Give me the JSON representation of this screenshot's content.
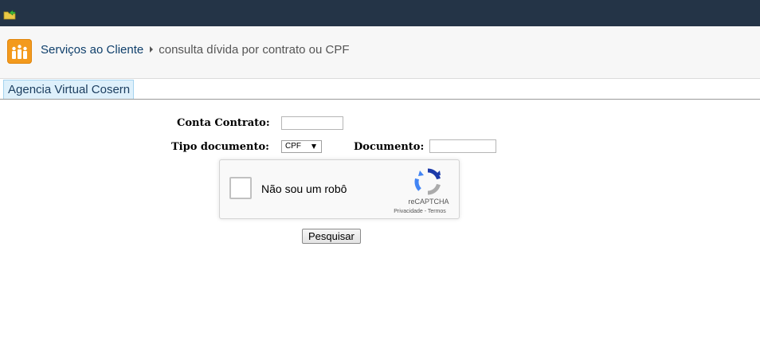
{
  "header": {
    "breadcrumb_root": "Serviços ao Cliente",
    "breadcrumb_current": "consulta dívida por contrato ou CPF"
  },
  "tab": {
    "label": "Agencia Virtual Cosern"
  },
  "form": {
    "conta_contrato_label": "Conta Contrato:",
    "conta_contrato_value": "",
    "tipo_documento_label": "Tipo documento:",
    "tipo_documento_selected": "CPF",
    "documento_label": "Documento:",
    "documento_value": "",
    "submit_label": "Pesquisar"
  },
  "recaptcha": {
    "checkbox_label": "Não sou um robô",
    "brand": "reCAPTCHA",
    "links": "Privacidade - Termos"
  },
  "colors": {
    "topbar": "#243447",
    "logo": "#f39a1d",
    "tab_bg": "#def0fb",
    "recaptcha_blue": "#1c3aa9",
    "recaptcha_lightblue": "#4285f4"
  },
  "icons": {
    "topbar_icon": "folder-arrow-icon",
    "site_logo": "people-icon",
    "breadcrumb_separator": "caret-right-icon",
    "select_arrow": "dropdown-arrow-icon",
    "recaptcha_logo": "recaptcha-logo-icon"
  }
}
